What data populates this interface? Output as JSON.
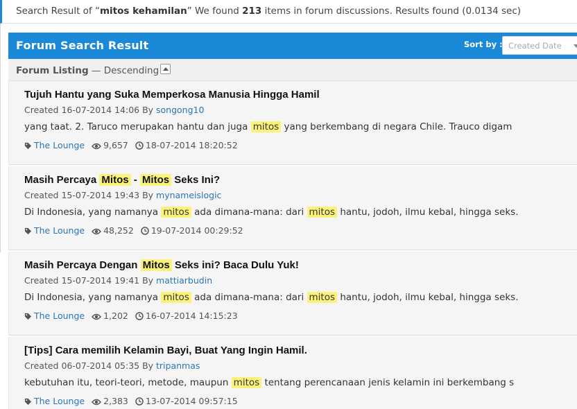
{
  "summary": {
    "prefix": "Search Result of “",
    "query": "mitos kehamilan",
    "middle": "” We found ",
    "count": "213",
    "suffix": " items in forum discussions. Results found (0.0134 sec)"
  },
  "header": {
    "title": "Forum Search Result",
    "sort_label": "Sort by :",
    "sort_selected": "Created Date"
  },
  "listing": {
    "label": "Forum Listing",
    "dash": " — ",
    "order": "Descending"
  },
  "colors": {
    "brand_blue": "#1a8ad8",
    "highlight": "#fbf27a",
    "link": "#2a75b8"
  },
  "results": [
    {
      "title": {
        "before": "Tujuh Hantu yang Suka Memperkosa Manusia Hingga Hamil",
        "hl1": "",
        "sep": "",
        "hl2": "",
        "after": ""
      },
      "created_label": "Created ",
      "created": "16-07-2014 14:06",
      "by_label": " By ",
      "author": "songong10",
      "snippet": {
        "before": "yang taat. 2. Taruco merupakan hantu dan juga ",
        "hl1": "mitos",
        "mid": " yang berkembang di negara Chile. Trauco digam",
        "hl2": "",
        "after": ""
      },
      "forum": "The Lounge",
      "views": "9,657",
      "last_post": "18-07-2014 18:20:52"
    },
    {
      "title": {
        "before": "Masih Percaya ",
        "hl1": "Mitos",
        "sep": " - ",
        "hl2": "Mitos",
        "after": " Seks Ini?"
      },
      "created_label": "Created ",
      "created": "15-07-2014 19:43",
      "by_label": " By ",
      "author": "mynameislogic",
      "snippet": {
        "before": "Di Indonesia, yang namanya ",
        "hl1": "mitos",
        "mid": " ada dimana-mana: dari ",
        "hl2": "mitos",
        "after": " hantu, jodoh, ilmu kebal, hingga seks."
      },
      "forum": "The Lounge",
      "views": "48,252",
      "last_post": "19-07-2014 00:29:52"
    },
    {
      "title": {
        "before": "Masih Percaya Dengan ",
        "hl1": "Mitos",
        "sep": "",
        "hl2": "",
        "after": " Seks ini? Baca Dulu Yuk!"
      },
      "created_label": "Created ",
      "created": "15-07-2014 19:41",
      "by_label": " By ",
      "author": "mattiarbudin",
      "snippet": {
        "before": "Di Indonesia, yang namanya ",
        "hl1": "mitos",
        "mid": " ada dimana-mana: dari ",
        "hl2": "mitos",
        "after": " hantu, jodoh, ilmu kebal, hingga seks."
      },
      "forum": "The Lounge",
      "views": "1,202",
      "last_post": "16-07-2014 14:15:23"
    },
    {
      "title": {
        "before": "[Tips] Cara memilih Kelamin Bayi, Buat Yang Ingin Hamil.",
        "hl1": "",
        "sep": "",
        "hl2": "",
        "after": ""
      },
      "created_label": "Created ",
      "created": "06-07-2014 05:35",
      "by_label": " By ",
      "author": "tripanmas",
      "snippet": {
        "before": "kebutuhan itu, teori-teori, metode, maupun ",
        "hl1": "mitos",
        "mid": " tentang perencanaan jenis kelamin ini berkembang s",
        "hl2": "",
        "after": ""
      },
      "forum": "The Lounge",
      "views": "2,383",
      "last_post": "13-07-2014 09:57:15"
    }
  ]
}
